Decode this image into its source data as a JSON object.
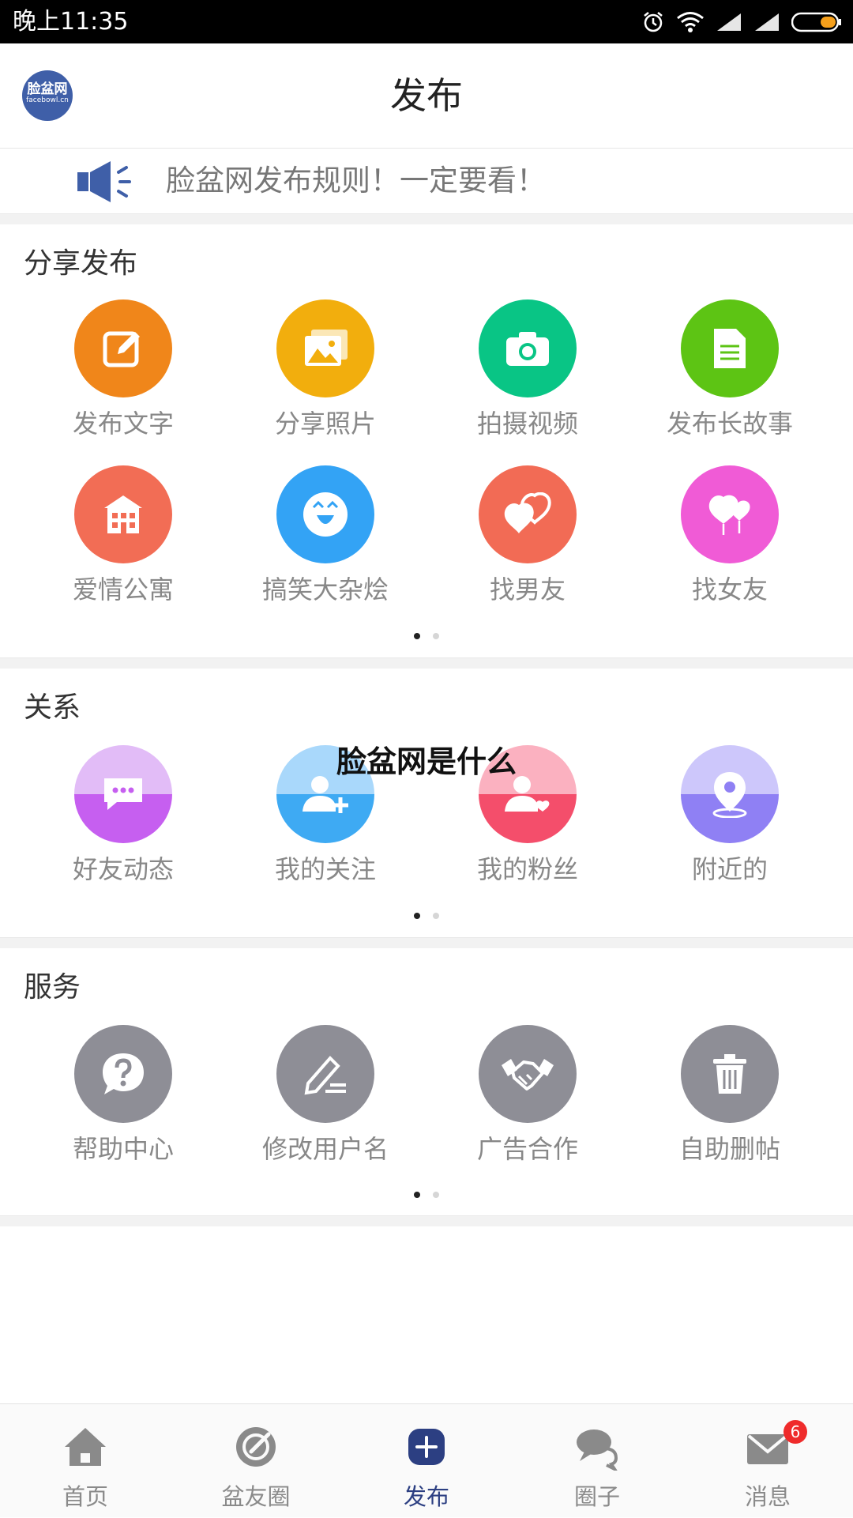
{
  "status_bar": {
    "time": "晚上11:35"
  },
  "header": {
    "logo_text": "脸盆网",
    "logo_sub": "facebowl.cn",
    "title": "发布"
  },
  "notice": {
    "text": "脸盆网发布规则！一定要看！",
    "icon": "megaphone-icon"
  },
  "share": {
    "title": "分享发布",
    "items": [
      {
        "label": "发布文字",
        "icon": "edit-icon",
        "color": "#f0861a"
      },
      {
        "label": "分享照片",
        "icon": "photo-icon",
        "color": "#f2ae0d"
      },
      {
        "label": "拍摄视频",
        "icon": "camera-icon",
        "color": "#09c585"
      },
      {
        "label": "发布长故事",
        "icon": "document-icon",
        "color": "#5dc414"
      },
      {
        "label": "爱情公寓",
        "icon": "building-icon",
        "color": "#f26d55"
      },
      {
        "label": "搞笑大杂烩",
        "icon": "laugh-face-icon",
        "color": "#33a3f5"
      },
      {
        "label": "找男友",
        "icon": "hearts-icon",
        "color": "#f26b55"
      },
      {
        "label": "找女友",
        "icon": "heart-balloons-icon",
        "color": "#f05bd6"
      }
    ]
  },
  "relation": {
    "title": "关系",
    "items": [
      {
        "label": "好友动态",
        "icon": "chat-bubble-icon",
        "color_top": "#e2bcf7",
        "color_bottom": "#c65ff0"
      },
      {
        "label": "我的关注",
        "icon": "add-user-icon",
        "color_top": "#a9d8fb",
        "color_bottom": "#3eaaf3"
      },
      {
        "label": "我的粉丝",
        "icon": "user-heart-icon",
        "color_top": "#fbb1c0",
        "color_bottom": "#f44e6b"
      },
      {
        "label": "附近的",
        "icon": "location-pin-icon",
        "color_top": "#cdc7fb",
        "color_bottom": "#8f80f4"
      }
    ]
  },
  "overlay_caption": "脸盆网是什么",
  "service": {
    "title": "服务",
    "items": [
      {
        "label": "帮助中心",
        "icon": "help-icon",
        "color": "#8e8e96"
      },
      {
        "label": "修改用户名",
        "icon": "pen-icon",
        "color": "#8e8e96"
      },
      {
        "label": "广告合作",
        "icon": "handshake-icon",
        "color": "#8e8e96"
      },
      {
        "label": "自助删帖",
        "icon": "trash-icon",
        "color": "#8e8e96"
      }
    ]
  },
  "bottom_nav": {
    "items": [
      {
        "label": "首页",
        "icon": "home-icon"
      },
      {
        "label": "盆友圈",
        "icon": "discover-icon"
      },
      {
        "label": "发布",
        "icon": "add-circle-icon",
        "active": true
      },
      {
        "label": "圈子",
        "icon": "chat-icon"
      },
      {
        "label": "消息",
        "icon": "mail-icon",
        "badge": "6"
      }
    ],
    "active_color": "#2c3f82",
    "inactive_color": "#8a8a8a"
  }
}
